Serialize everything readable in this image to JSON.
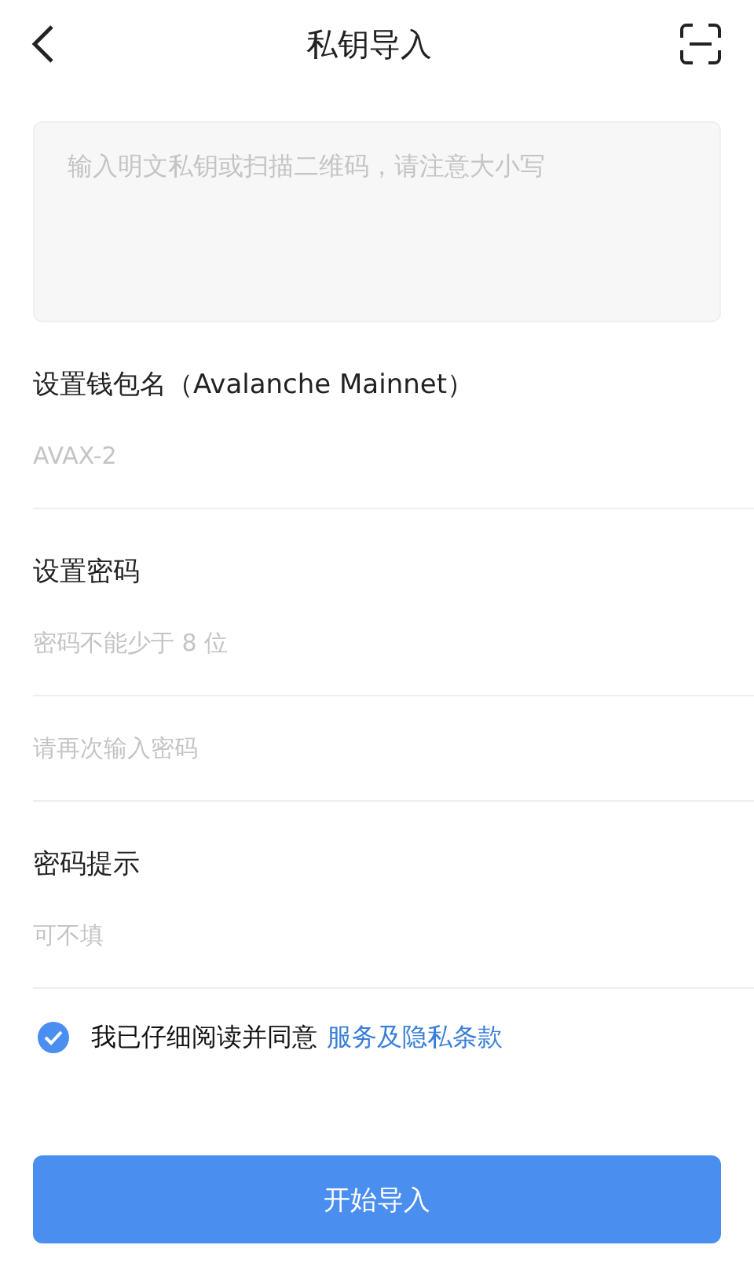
{
  "header": {
    "title": "私钥导入"
  },
  "key_input": {
    "placeholder": "输入明文私钥或扫描二维码，请注意大小写"
  },
  "sections": [
    {
      "label": "设置钱包名（Avalanche Mainnet）",
      "fields": [
        {
          "placeholder": "AVAX-2"
        }
      ]
    },
    {
      "label": "设置密码",
      "fields": [
        {
          "placeholder": "密码不能少于 8 位"
        },
        {
          "placeholder": "请再次输入密码"
        }
      ]
    },
    {
      "label": "密码提示",
      "fields": [
        {
          "placeholder": "可不填"
        }
      ]
    }
  ],
  "agreement": {
    "checked": true,
    "text": "我已仔细阅读并同意",
    "link": "服务及隐私条款"
  },
  "submit_button": "开始导入"
}
